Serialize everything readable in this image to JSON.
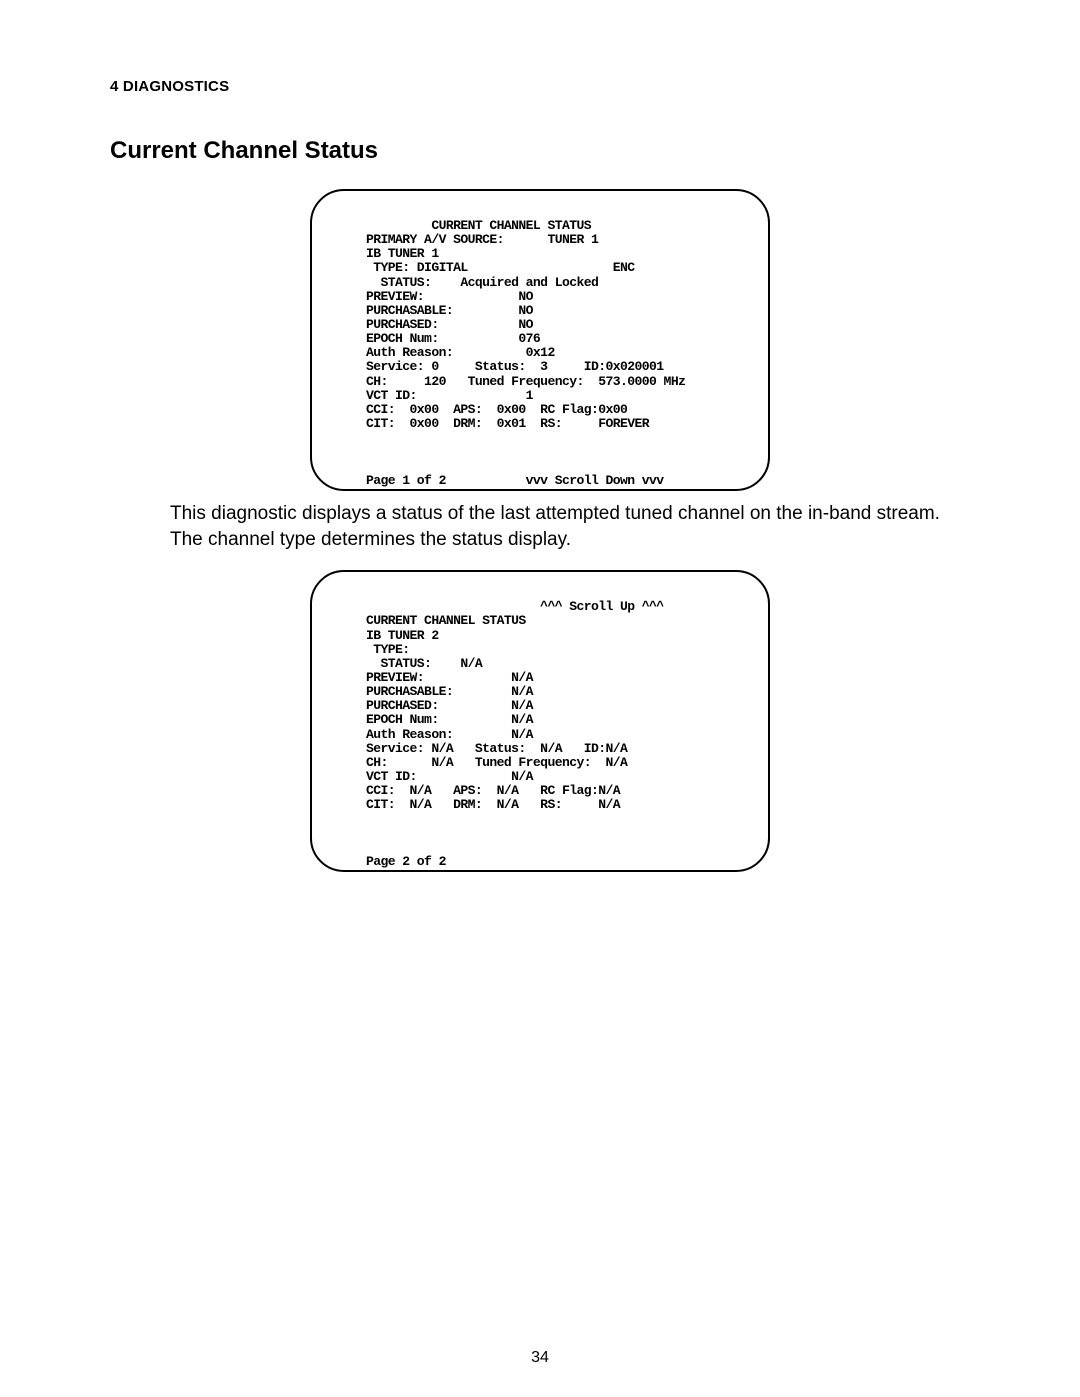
{
  "section_header": "4 DIAGNOSTICS",
  "title": "Current Channel Status",
  "screen1": {
    "title": "         CURRENT CHANNEL STATUS",
    "line2": "PRIMARY A/V SOURCE:      TUNER 1",
    "line3": "IB TUNER 1",
    "line4": " TYPE: DIGITAL                    ENC",
    "line5": "  STATUS:    Acquired and Locked",
    "line6": "PREVIEW:             NO",
    "line7": "PURCHASABLE:         NO",
    "line8": "PURCHASED:           NO",
    "line9": "EPOCH Num:           076",
    "line10": "Auth Reason:          0x12",
    "line11": "Service: 0     Status:  3     ID:0x020001",
    "line12": "CH:     120   Tuned Frequency:  573.0000 MHz",
    "line13": "VCT ID:               1",
    "line14": "CCI:  0x00  APS:  0x00  RC Flag:0x00",
    "line15": "CIT:  0x00  DRM:  0x01  RS:     FOREVER",
    "blank": "",
    "footer": "Page 1 of 2           vvv Scroll Down vvv"
  },
  "body_text": "This diagnostic displays a status of the last attempted tuned channel on the in-band stream. The channel type determines the status display.",
  "screen2": {
    "scrollup": "                        ^^^ Scroll Up ^^^",
    "title": "CURRENT CHANNEL STATUS",
    "line2": "IB TUNER 2",
    "line3": " TYPE:",
    "line4": "  STATUS:    N/A",
    "line5": "PREVIEW:            N/A",
    "line6": "PURCHASABLE:        N/A",
    "line7": "PURCHASED:          N/A",
    "line8": "EPOCH Num:          N/A",
    "line9": "Auth Reason:        N/A",
    "line10": "Service: N/A   Status:  N/A   ID:N/A",
    "line11": "CH:      N/A   Tuned Frequency:  N/A",
    "line12": "VCT ID:             N/A",
    "line13": "CCI:  N/A   APS:  N/A   RC Flag:N/A",
    "line14": "CIT:  N/A   DRM:  N/A   RS:     N/A",
    "blank": "",
    "footer": "Page 2 of 2"
  },
  "page_number": "34"
}
